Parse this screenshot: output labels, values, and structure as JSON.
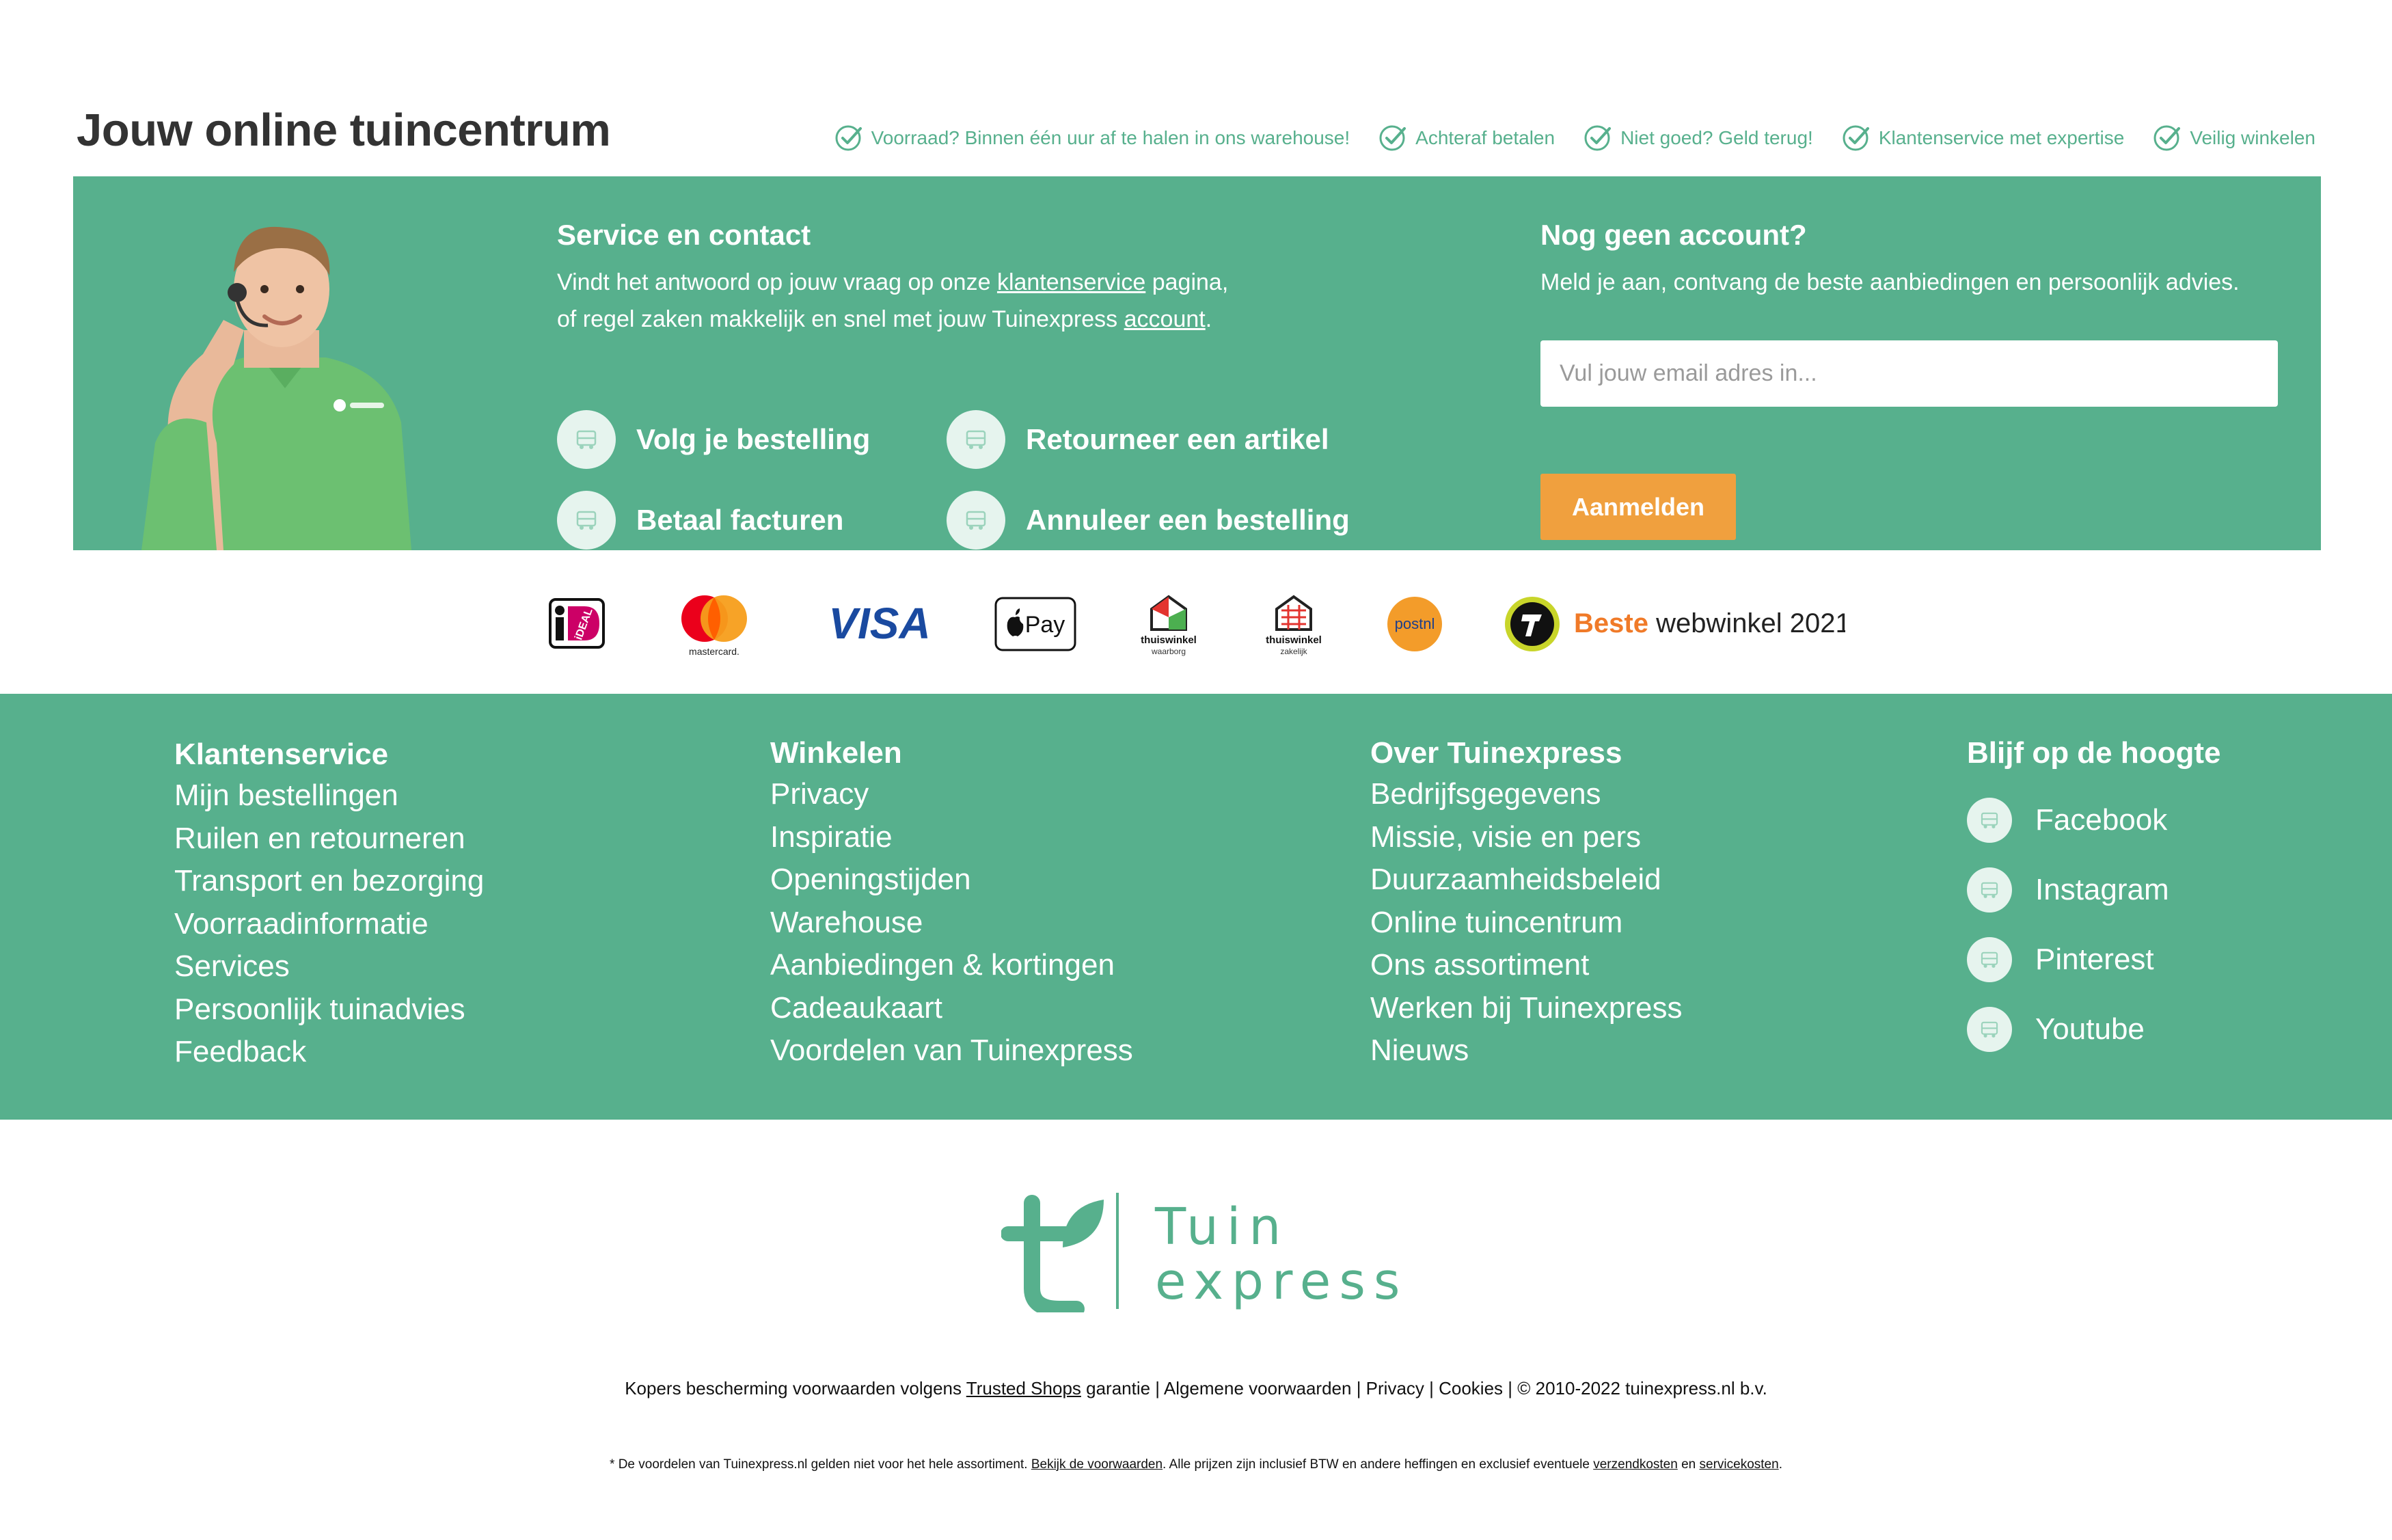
{
  "header": {
    "title": "Jouw online tuincentrum",
    "usps": [
      "Voorraad? Binnen één uur af te halen in ons warehouse!",
      "Achteraf betalen",
      "Niet goed? Geld terug!",
      "Klantenservice met expertise",
      "Veilig winkelen"
    ]
  },
  "service": {
    "title": "Service en contact",
    "text_1": "Vindt het antwoord op jouw vraag op onze ",
    "link_1": "klantenservice",
    "text_2": " pagina,",
    "text_3": "of regel zaken makkelijk en snel met jouw Tuinexpress ",
    "link_2": "account",
    "text_4": ".",
    "links": [
      "Volg je bestelling",
      "Retourneer een artikel",
      "Betaal facturen",
      "Annuleer een bestelling"
    ]
  },
  "account": {
    "title": "Nog geen account?",
    "text": "Meld je aan, contvang de beste aanbiedingen en persoonlijk advies.",
    "email_placeholder": "Vul jouw email adres in...",
    "button": "Aanmelden"
  },
  "payments": {
    "ideal": "iDEAL",
    "mastercard": "mastercard.",
    "visa": "VISA",
    "applepay": "Pay",
    "thuiswinkel_1": "thuiswinkel",
    "thuiswinkel_1_sub": "waarborg",
    "thuiswinkel_2": "thuiswinkel",
    "thuiswinkel_2_sub": "zakelijk",
    "postnl": "postnl",
    "beste_1": "Beste",
    "beste_2": " webwinkel 2021"
  },
  "footer": {
    "col1": {
      "title": "Klantenservice",
      "items": [
        "Mijn bestellingen",
        "Ruilen en retourneren",
        "Transport en bezorging",
        "Voorraadinformatie",
        "Services",
        "Persoonlijk tuinadvies",
        "Feedback"
      ]
    },
    "col2": {
      "title": "Winkelen",
      "items": [
        "Privacy",
        "Inspiratie",
        "Openingstijden",
        "Warehouse",
        "Aanbiedingen & kortingen",
        "Cadeaukaart",
        "Voordelen van Tuinexpress"
      ]
    },
    "col3": {
      "title": "Over Tuinexpress",
      "items": [
        "Bedrijfsgegevens",
        "Missie, visie en pers",
        "Duurzaamheidsbeleid",
        "Online tuincentrum",
        "Ons assortiment",
        "Werken bij Tuinexpress",
        "Nieuws"
      ]
    },
    "col4": {
      "title": "Blijf op de hoogte",
      "items": [
        "Facebook",
        "Instagram",
        "Pinterest",
        "Youtube"
      ]
    }
  },
  "logo": {
    "line1": "Tuin",
    "line2": "express",
    "mark": "t"
  },
  "legal": {
    "t1": "Kopers bescherming voorwaarden volgens ",
    "l1": "Trusted Shops",
    "t2": " garantie | Algemene voorwaarden | Privacy | Cookies | © 2010-2022 tuinexpress.nl b.v."
  },
  "disclaimer": {
    "t1": "* De voordelen van Tuinexpress.nl gelden niet voor het hele assortiment. ",
    "l1": "Bekijk de voorwaarden",
    "t2": ". Alle prijzen zijn inclusief BTW en andere heffingen en exclusief eventuele ",
    "l2": "verzendkosten",
    "t3": " en ",
    "l3": "servicekosten",
    "t4": "."
  },
  "colors": {
    "brand_green": "#57b08d",
    "accent_orange": "#f0a03e",
    "icon_circle": "#e6f4ee"
  },
  "icons": {
    "usp": "check-circle-icon",
    "service": "truck-icon",
    "social": "truck-icon"
  }
}
